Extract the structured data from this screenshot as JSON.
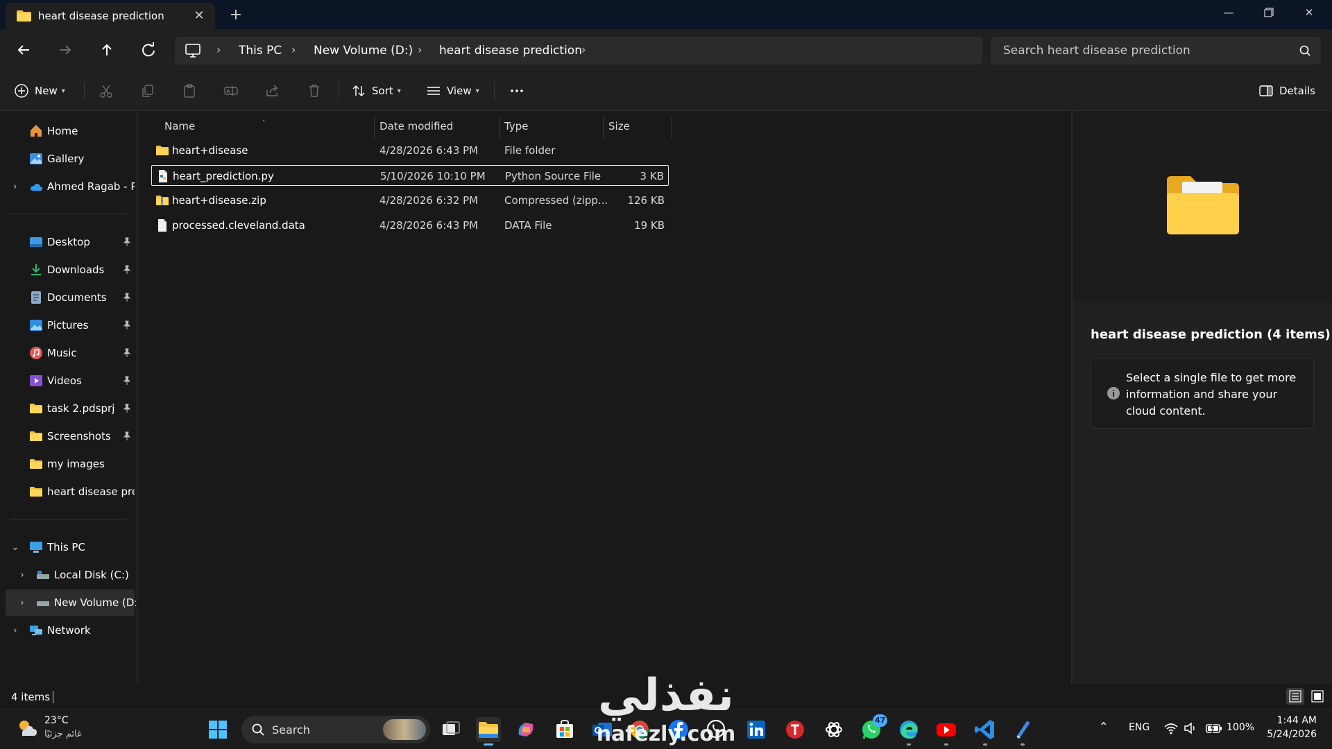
{
  "window": {
    "tab_title": "heart disease prediction"
  },
  "address": {
    "crumbs": [
      "This PC",
      "New Volume (D:)",
      "heart disease prediction"
    ],
    "search_placeholder": "Search heart disease prediction"
  },
  "toolbar": {
    "new_label": "New",
    "sort_label": "Sort",
    "view_label": "View",
    "details_label": "Details"
  },
  "sidebar": {
    "top": [
      {
        "label": "Home",
        "icon": "home-icon"
      },
      {
        "label": "Gallery",
        "icon": "gallery-icon"
      },
      {
        "label": "Ahmed Ragab - Personal",
        "icon": "onedrive-icon"
      }
    ],
    "quick_access": [
      {
        "label": "Desktop",
        "icon": "desktop-icon"
      },
      {
        "label": "Downloads",
        "icon": "downloads-icon"
      },
      {
        "label": "Documents",
        "icon": "documents-icon"
      },
      {
        "label": "Pictures",
        "icon": "pictures-icon"
      },
      {
        "label": "Music",
        "icon": "music-icon"
      },
      {
        "label": "Videos",
        "icon": "videos-icon"
      },
      {
        "label": "task 2.pdsprj",
        "icon": "folder-icon"
      },
      {
        "label": "Screenshots",
        "icon": "folder-icon"
      },
      {
        "label": "my images",
        "icon": "folder-icon"
      },
      {
        "label": "heart disease prediction",
        "icon": "folder-icon"
      }
    ],
    "this_pc": {
      "label": "This PC",
      "icon": "computer-icon"
    },
    "drives": [
      {
        "label": "Local Disk (C:)",
        "icon": "drive-icon"
      },
      {
        "label": "New Volume (D:)",
        "icon": "drive-icon"
      }
    ],
    "network": {
      "label": "Network",
      "icon": "network-icon"
    }
  },
  "files": {
    "columns": [
      "Name",
      "Date modified",
      "Type",
      "Size"
    ],
    "rows": [
      {
        "name": "heart+disease",
        "date": "4/28/2026 6:43 PM",
        "type": "File folder",
        "size": "",
        "icon": "folder-icon"
      },
      {
        "name": "heart_prediction.py",
        "date": "5/10/2026 10:10 PM",
        "type": "Python Source File",
        "size": "3 KB",
        "icon": "python-file-icon"
      },
      {
        "name": "heart+disease.zip",
        "date": "4/28/2026 6:32 PM",
        "type": "Compressed (zipp...",
        "size": "126 KB",
        "icon": "zip-folder-icon"
      },
      {
        "name": "processed.cleveland.data",
        "date": "4/28/2026 6:43 PM",
        "type": "DATA File",
        "size": "19 KB",
        "icon": "file-icon"
      }
    ]
  },
  "details": {
    "title": "heart disease prediction (4 items)",
    "info": "Select a single file to get more information and share your cloud content."
  },
  "status": {
    "item_count": "4 items"
  },
  "taskbar": {
    "temperature": "23°C",
    "condition": "غائم جزئيًا",
    "search_label": "Search",
    "whatsapp_badge": "47",
    "language": "ENG",
    "battery": "100%",
    "time": "1:44 AM",
    "date": "5/24/2026"
  },
  "watermark": {
    "arabic": "نفذلي",
    "latin": "nafezly.com"
  }
}
